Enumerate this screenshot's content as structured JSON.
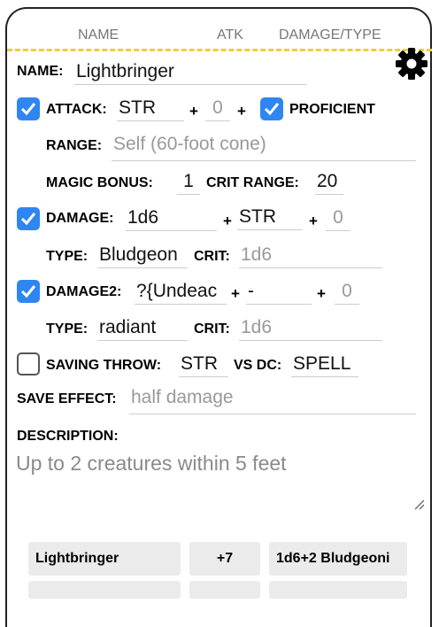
{
  "header": {
    "name": "NAME",
    "atk": "ATK",
    "damage_type": "DAMAGE/TYPE"
  },
  "icons": {
    "settings": "gear-icon",
    "check": "check-icon",
    "resize": "resize-grip-icon"
  },
  "colors": {
    "accent": "#2f86f2",
    "dash": "#f2cc3a"
  },
  "form": {
    "name_label": "NAME:",
    "name_value": "Lightbringer",
    "attack_label": "ATTACK:",
    "attack_checked": true,
    "attack_stat": "STR",
    "attack_bonus_placeholder": "0",
    "proficient_label": "PROFICIENT",
    "proficient_checked": true,
    "range_label": "RANGE:",
    "range_placeholder": "Self (60-foot cone)",
    "magic_bonus_label": "MAGIC BONUS:",
    "magic_bonus_value": "1",
    "crit_range_label": "CRIT RANGE:",
    "crit_range_value": "20",
    "damage_label": "DAMAGE:",
    "damage_checked": true,
    "damage_value": "1d6",
    "damage_stat": "STR",
    "damage_bonus_placeholder": "0",
    "type_label": "TYPE:",
    "type_value": "Bludgeon",
    "crit_label": "CRIT:",
    "crit_placeholder": "1d6",
    "damage2_label": "DAMAGE2:",
    "damage2_checked": true,
    "damage2_value": "?{Undeac",
    "damage2_stat": "-",
    "damage2_bonus_placeholder": "0",
    "type2_label": "TYPE:",
    "type2_value": "radiant",
    "crit2_label": "CRIT:",
    "crit2_placeholder": "1d6",
    "saving_throw_label": "SAVING THROW:",
    "saving_throw_checked": false,
    "saving_throw_stat": "STR",
    "vs_dc_label": "VS DC:",
    "vs_dc_value": "SPELL",
    "save_effect_label": "SAVE EFFECT:",
    "save_effect_placeholder": "half damage",
    "description_label": "DESCRIPTION:",
    "description_placeholder": "Up to 2 creatures within 5 feet",
    "plus": "+"
  },
  "summary_row": {
    "name": "Lightbringer",
    "atk": "+7",
    "damage": "1d6+2 Bludgeoni"
  }
}
